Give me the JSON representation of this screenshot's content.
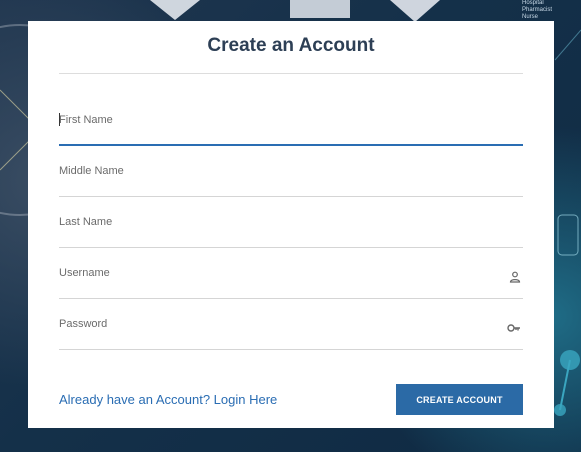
{
  "form": {
    "title": "Create an Account",
    "fields": [
      {
        "label": "First Name",
        "value": "",
        "icon": null
      },
      {
        "label": "Middle Name",
        "value": "",
        "icon": null
      },
      {
        "label": "Last Name",
        "value": "",
        "icon": null
      },
      {
        "label": "Username",
        "value": "",
        "icon": "user-icon"
      },
      {
        "label": "Password",
        "value": "",
        "icon": "key-icon"
      }
    ],
    "login_link": "Already have an Account? Login Here",
    "submit_label": "CREATE ACCOUNT"
  },
  "background": {
    "text_lines": [
      "Hospital",
      "Pharmacist",
      "Nurse"
    ]
  },
  "colors": {
    "accent": "#2a6db3",
    "button": "#2b6aa6",
    "title": "#2d3f55"
  }
}
